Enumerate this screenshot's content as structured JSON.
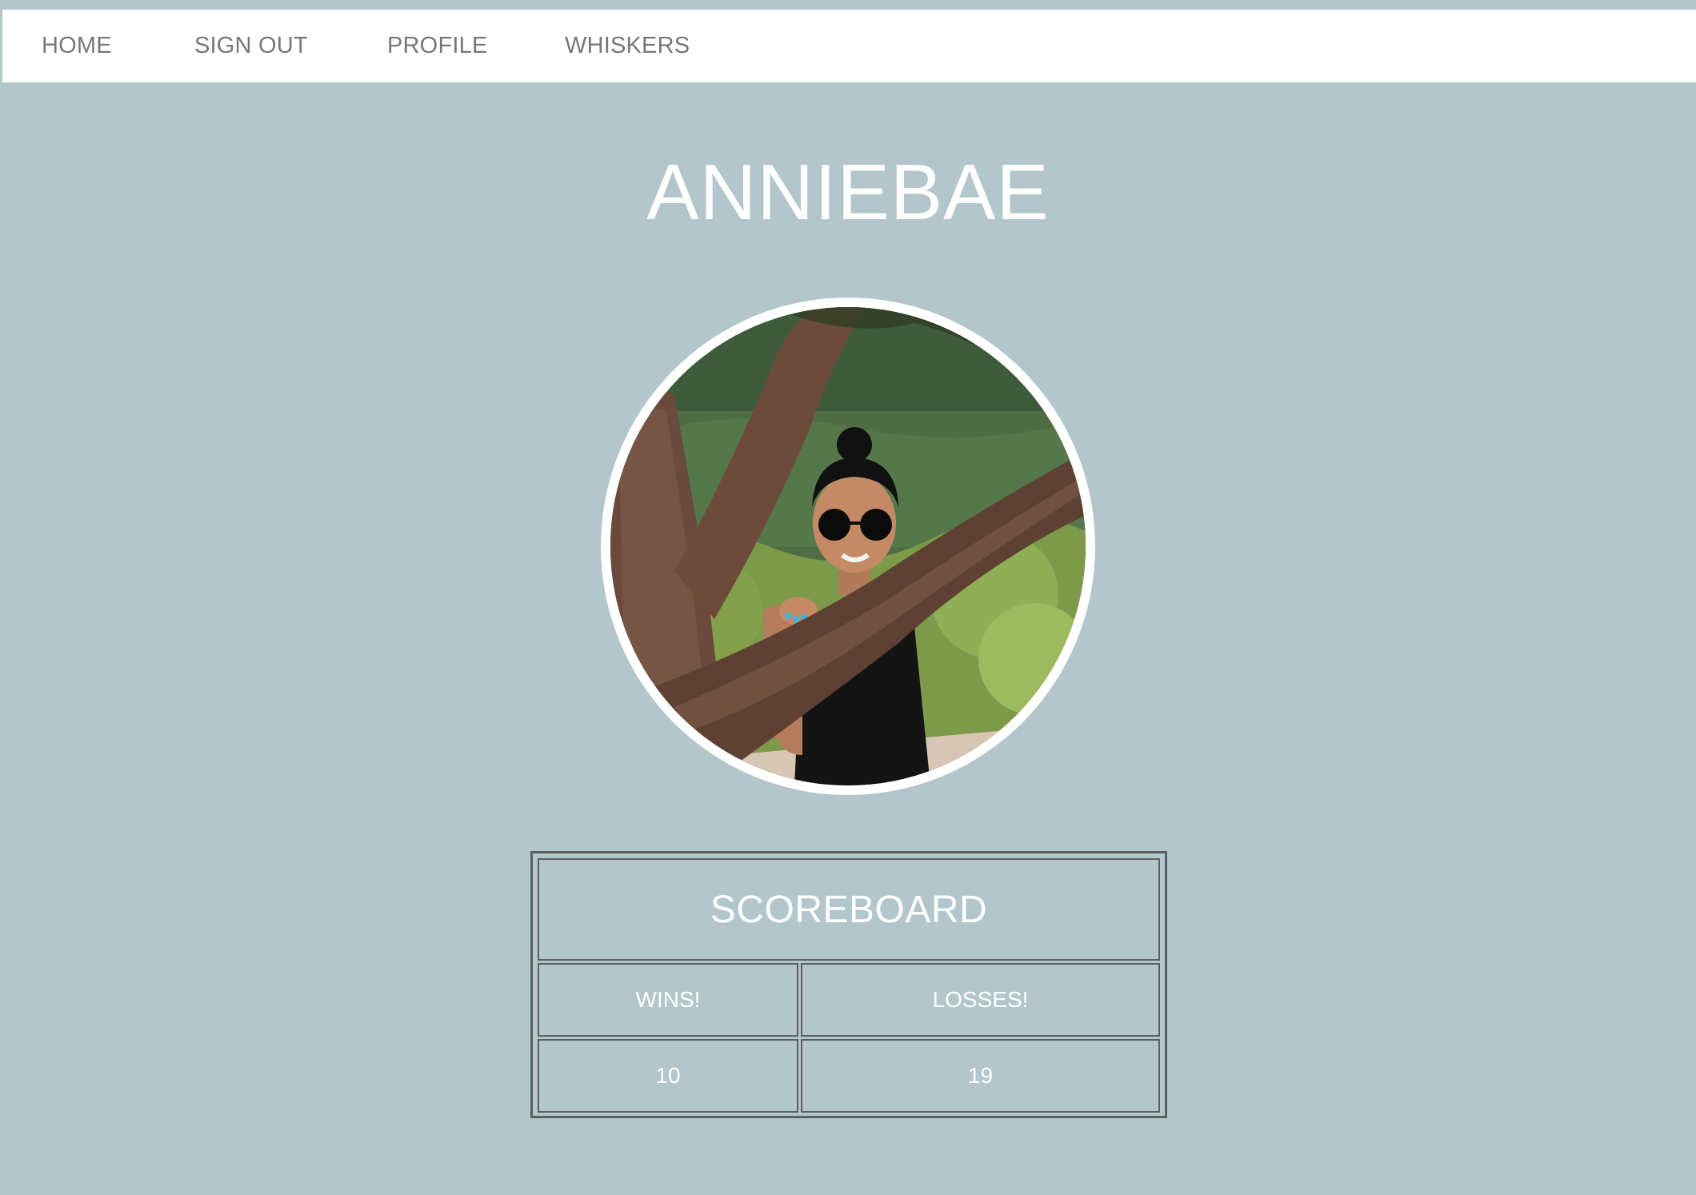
{
  "nav": {
    "home": "HOME",
    "sign_out": "SIGN OUT",
    "profile": "PROFILE",
    "whiskers": "WHISKERS"
  },
  "profile": {
    "username": "ANNIEBAE",
    "avatar_icon": "profile-photo"
  },
  "scoreboard": {
    "title": "SCOREBOARD",
    "headers": [
      "WINS!",
      "LOSSES!"
    ],
    "values": [
      "10",
      "19"
    ]
  },
  "colors": {
    "background": "#b2c6cc",
    "navbar": "#ffffff",
    "nav_text": "#777777",
    "title_text": "#ffffff",
    "table_border": "#5a5f61"
  }
}
